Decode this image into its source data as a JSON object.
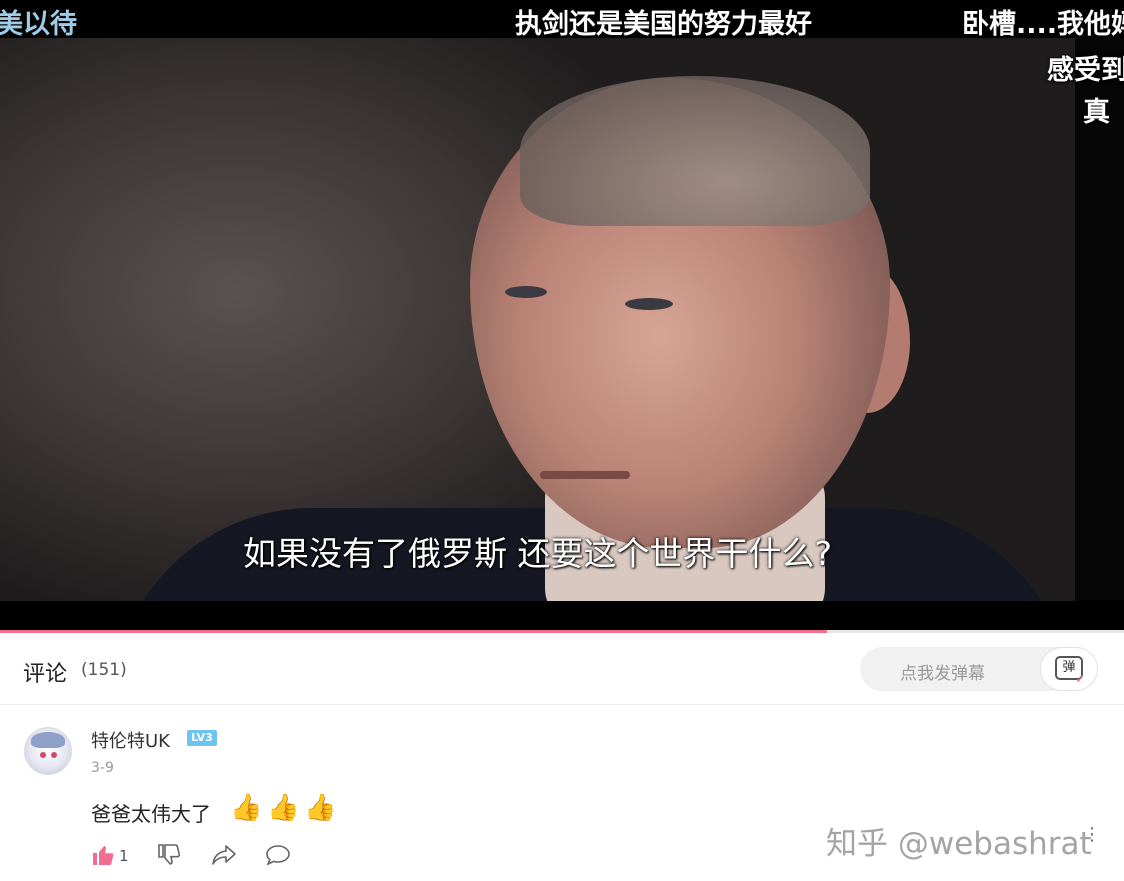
{
  "video": {
    "danmaku": [
      "美以待",
      "执剑还是美国的努力最好",
      "卧槽....我他妈",
      "感受到",
      "真"
    ],
    "subtitle": "如果没有了俄罗斯 还要这个世界干什么?",
    "progress": 0.736,
    "accent_color": "#f26c8f"
  },
  "comments_header": {
    "title": "评论",
    "count": "(151)",
    "danmaku_placeholder": "点我发弹幕",
    "danmaku_button_label": "弹"
  },
  "comment": {
    "username": "特伦特UK",
    "level": "LV3",
    "date": "3-9",
    "text": "爸爸太伟大了",
    "emojis": [
      "👍",
      "👍",
      "👍"
    ],
    "like_count": "1",
    "icons": [
      "thumbs-up-icon",
      "thumbs-down-icon",
      "share-icon",
      "reply-icon"
    ]
  },
  "watermark": "知乎 @webashrat"
}
